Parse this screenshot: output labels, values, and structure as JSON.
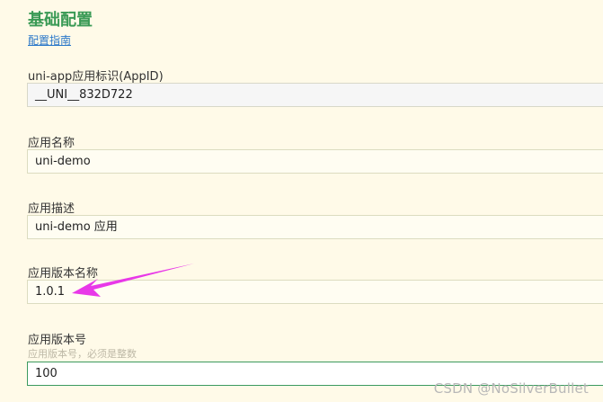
{
  "section": {
    "title": "基础配置",
    "guide_link": "配置指南"
  },
  "fields": {
    "appid": {
      "label": "uni-app应用标识(AppID)",
      "value": "__UNI__832D722"
    },
    "app_name": {
      "label": "应用名称",
      "value": "uni-demo"
    },
    "app_description": {
      "label": "应用描述",
      "value": "uni-demo 应用"
    },
    "version_name": {
      "label": "应用版本名称",
      "value": "1.0.1"
    },
    "version_code": {
      "label": "应用版本号",
      "hint": "应用版本号，必须是整数",
      "value": "100"
    }
  },
  "annotation": {
    "arrow_color": "#e838e8"
  },
  "watermark": "CSDN @NoSilverBullet"
}
